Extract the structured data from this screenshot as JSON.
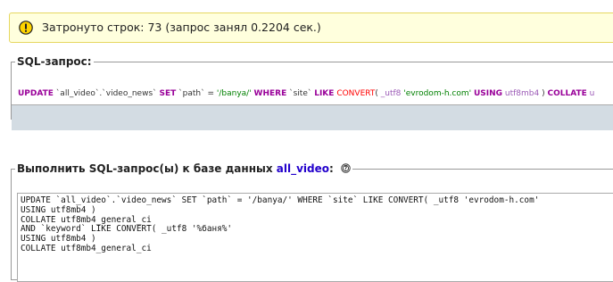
{
  "notice": {
    "icon": "warning-icon",
    "text": "Затронуто строк: 73 (запрос занял 0.2204 сек.)"
  },
  "sql_query_panel": {
    "legend": "SQL-запрос:",
    "tokens": [
      {
        "t": "UPDATE",
        "c": "kw"
      },
      {
        "t": " `all_video`.`video_news` ",
        "c": "blk"
      },
      {
        "t": "SET",
        "c": "kw"
      },
      {
        "t": " `path` = ",
        "c": "blk"
      },
      {
        "t": "'/banya/'",
        "c": "str"
      },
      {
        "t": " ",
        "c": "blk"
      },
      {
        "t": "WHERE",
        "c": "kw"
      },
      {
        "t": " `site` ",
        "c": "blk"
      },
      {
        "t": "LIKE",
        "c": "kw"
      },
      {
        "t": " ",
        "c": "blk"
      },
      {
        "t": "CONVERT",
        "c": "fn"
      },
      {
        "t": "( ",
        "c": "blk"
      },
      {
        "t": "_utf8",
        "c": "ty"
      },
      {
        "t": " ",
        "c": "blk"
      },
      {
        "t": "'evrodom-h.com'",
        "c": "str"
      },
      {
        "t": " ",
        "c": "blk"
      },
      {
        "t": "USING",
        "c": "kw"
      },
      {
        "t": " ",
        "c": "blk"
      },
      {
        "t": "utf8mb4",
        "c": "ty"
      },
      {
        "t": " ) ",
        "c": "blk"
      },
      {
        "t": "COLLATE",
        "c": "kw"
      },
      {
        "t": " u",
        "c": "ty"
      }
    ]
  },
  "run_query_panel": {
    "legend_prefix": "Выполнить SQL-запрос(ы) к базе данных ",
    "database_link": "all_video",
    "legend_suffix": ":",
    "help_icon": "help-icon",
    "textarea_value": "UPDATE `all_video`.`video_news` SET `path` = '/banya/' WHERE `site` LIKE CONVERT( _utf8 'evrodom-h.com'\nUSING utf8mb4 )\nCOLLATE utf8mb4_general_ci\nAND `keyword` LIKE CONVERT( _utf8 '%баня%'\nUSING utf8mb4 )\nCOLLATE utf8mb4_general_ci"
  },
  "colors": {
    "notice_bg": "#ffffdd",
    "notice_border": "#e6d760",
    "toolbar_bg": "#d3dce3",
    "keyword": "#990099",
    "string": "#008000",
    "function": "#ff0000",
    "db_link": "#2200cc"
  }
}
